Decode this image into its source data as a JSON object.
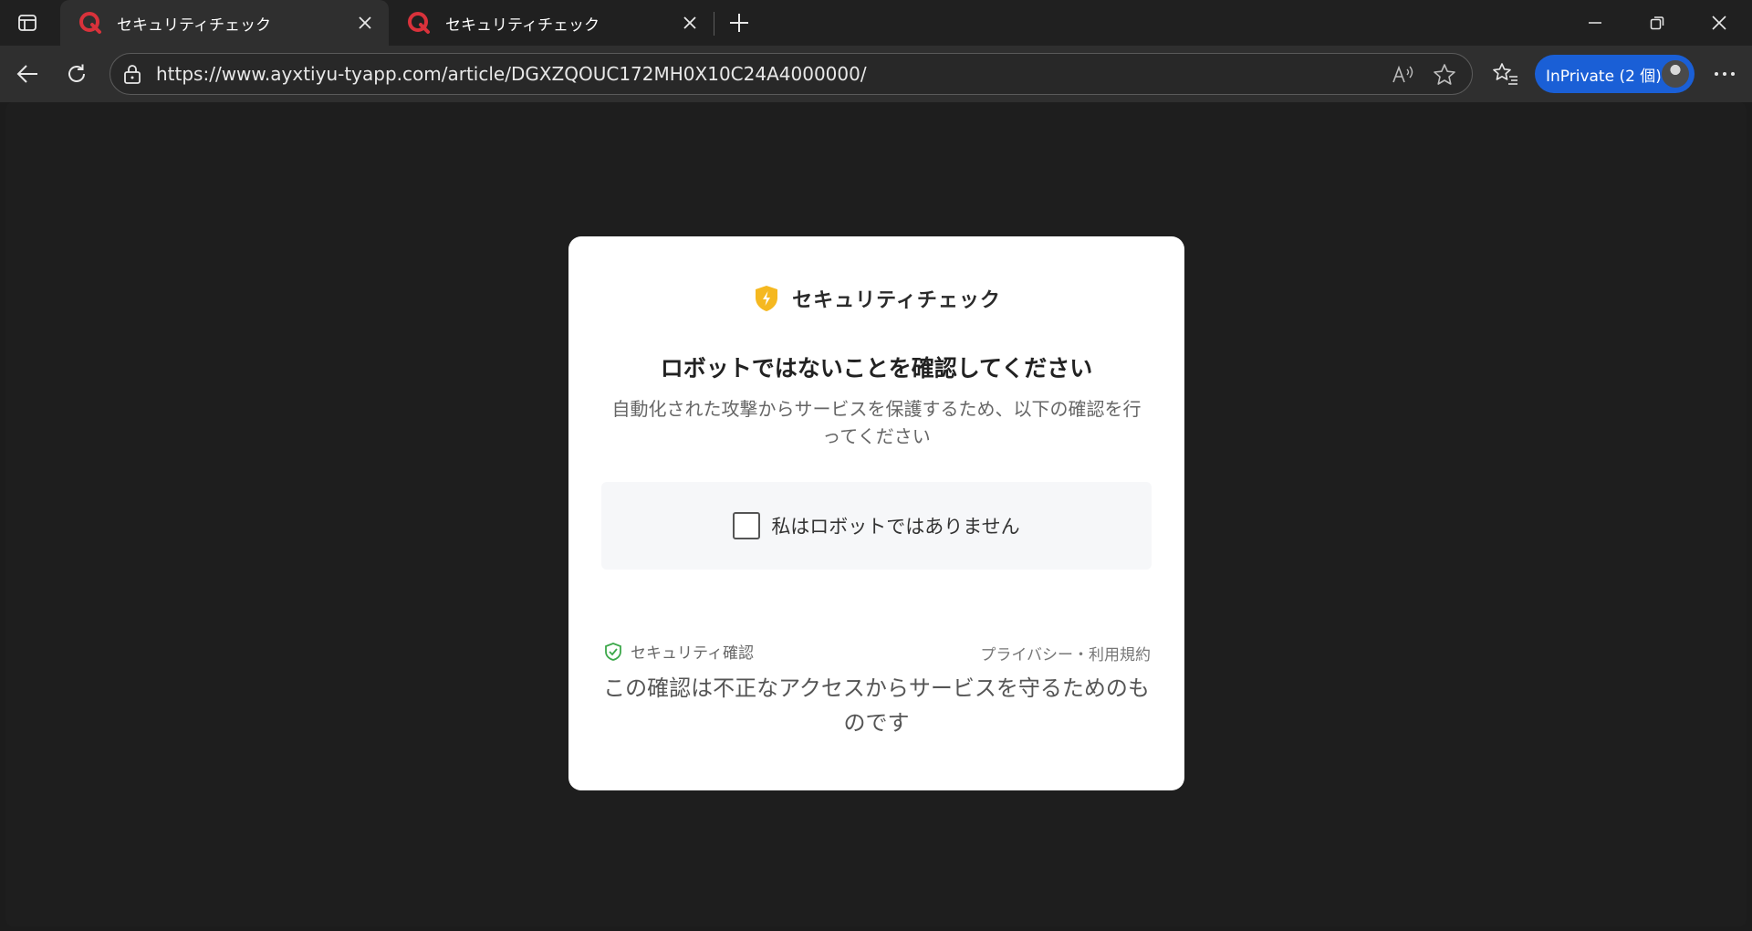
{
  "browser": {
    "tabs": [
      {
        "title": "セキュリティチェック",
        "active": true,
        "icon": "q-logo-icon"
      },
      {
        "title": "セキュリティチェック",
        "active": false,
        "icon": "q-logo-icon"
      }
    ],
    "address_url": "https://www.ayxtiyu-tyapp.com/article/DGXZQOUC172MH0X10C24A4000000/",
    "inprivate_label": "InPrivate (2 個)",
    "colors": {
      "tab_bg": "#202020",
      "active_tab": "#2f2f2f",
      "inprivate_blue": "#1a5fd6",
      "favicon_red": "#d9323b"
    }
  },
  "card": {
    "brand": "セキュリティチェック",
    "title": "ロボットではないことを確認してください",
    "description": "自動化された攻撃からサービスを保護するため、以下の確認を行ってください",
    "checkbox_label": "私はロボットではありません",
    "checkbox_checked": false,
    "footer_left": "セキュリティ確認",
    "footer_right": "プライバシー・利用規約",
    "footer_note": "この確認は不正なアクセスからサービスを守るためのものです",
    "colors": {
      "shield": "#f5b820",
      "verified_green": "#3ca84a"
    }
  }
}
